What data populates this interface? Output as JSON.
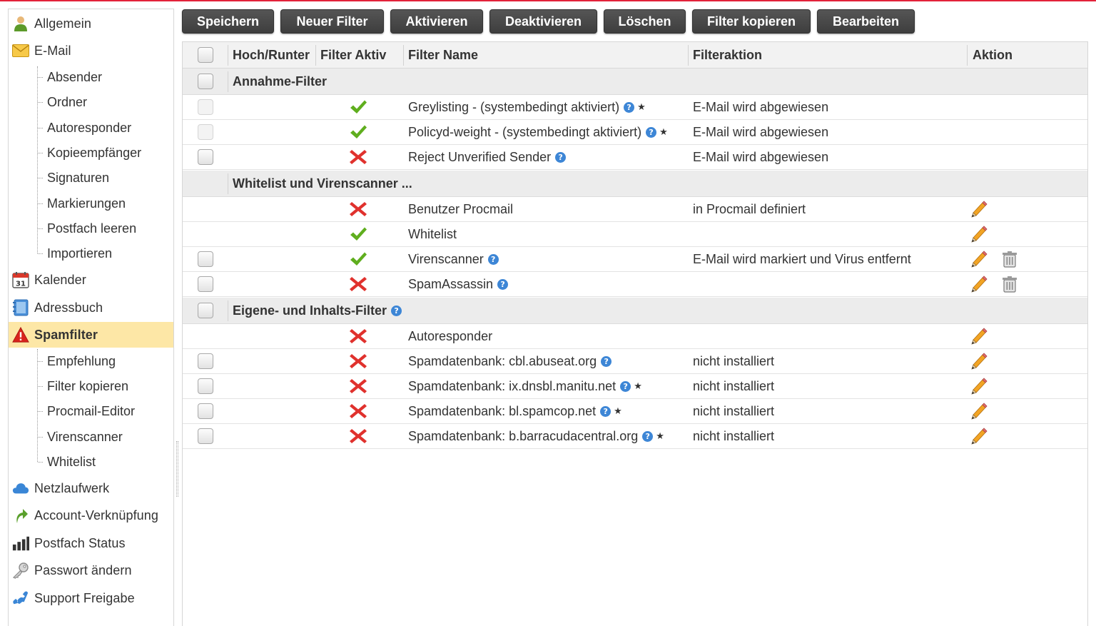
{
  "sidebar": {
    "items": [
      {
        "label": "Allgemein",
        "icon": "user-icon"
      },
      {
        "label": "E-Mail",
        "icon": "envelope-icon"
      },
      {
        "label": "Kalender",
        "icon": "calendar-icon",
        "icon_text": "31"
      },
      {
        "label": "Adressbuch",
        "icon": "addressbook-icon"
      },
      {
        "label": "Spamfilter",
        "icon": "warning-icon",
        "active": true
      },
      {
        "label": "Netzlaufwerk",
        "icon": "cloud-icon"
      },
      {
        "label": "Account-Verknüpfung",
        "icon": "link-arrow-icon"
      },
      {
        "label": "Postfach Status",
        "icon": "bar-chart-icon"
      },
      {
        "label": "Passwort ändern",
        "icon": "key-icon"
      },
      {
        "label": "Support Freigabe",
        "icon": "phone-icon"
      }
    ],
    "email_sub": [
      "Absender",
      "Ordner",
      "Autoresponder",
      "Kopieempfänger",
      "Signaturen",
      "Markierungen",
      "Postfach leeren",
      "Importieren"
    ],
    "spam_sub": [
      "Empfehlung",
      "Filter kopieren",
      "Procmail-Editor",
      "Virenscanner",
      "Whitelist"
    ]
  },
  "toolbar": {
    "save": "Speichern",
    "new_filter": "Neuer Filter",
    "activate": "Aktivieren",
    "deactivate": "Deaktivieren",
    "delete": "Löschen",
    "copy_filter": "Filter kopieren",
    "edit": "Bearbeiten"
  },
  "table": {
    "headers": {
      "updown": "Hoch/Runter",
      "active": "Filter Aktiv",
      "name": "Filter Name",
      "action_filter": "Filteraktion",
      "action": "Aktion"
    },
    "groups": {
      "g1": "Annahme-Filter",
      "g2": "Whitelist und Virenscanner ...",
      "g3": "Eigene- und Inhalts-Filter"
    },
    "rows": [
      {
        "name": "Greylisting - (systembedingt aktiviert)",
        "filteraction": "E-Mail wird abgewiesen",
        "active": true
      },
      {
        "name": "Policyd-weight - (systembedingt aktiviert)",
        "filteraction": "E-Mail wird abgewiesen",
        "active": true
      },
      {
        "name": "Reject Unverified Sender",
        "filteraction": "E-Mail wird abgewiesen",
        "active": false
      },
      {
        "name": "Benutzer Procmail",
        "filteraction": "in Procmail definiert",
        "active": false
      },
      {
        "name": "Whitelist",
        "filteraction": "",
        "active": true
      },
      {
        "name": "Virenscanner",
        "filteraction": "E-Mail wird markiert und Virus entfernt",
        "active": true
      },
      {
        "name": "SpamAssassin",
        "filteraction": "",
        "active": false
      },
      {
        "name": "Autoresponder",
        "filteraction": "",
        "active": false
      },
      {
        "name": "Spamdatenbank: cbl.abuseat.org",
        "filteraction": "nicht installiert",
        "active": false
      },
      {
        "name": "Spamdatenbank: ix.dnsbl.manitu.net",
        "filteraction": "nicht installiert",
        "active": false
      },
      {
        "name": "Spamdatenbank: bl.spamcop.net",
        "filteraction": "nicht installiert",
        "active": false
      },
      {
        "name": "Spamdatenbank: b.barracudacentral.org",
        "filteraction": "nicht installiert",
        "active": false
      }
    ],
    "help_glyph": "?",
    "star_glyph": "★"
  },
  "colors": {
    "accent_line": "#e3223a",
    "active_nav_bg": "#fde7a6",
    "button_bg": "#444444",
    "check_green": "#5fae1e",
    "cross_red": "#e0312d"
  }
}
